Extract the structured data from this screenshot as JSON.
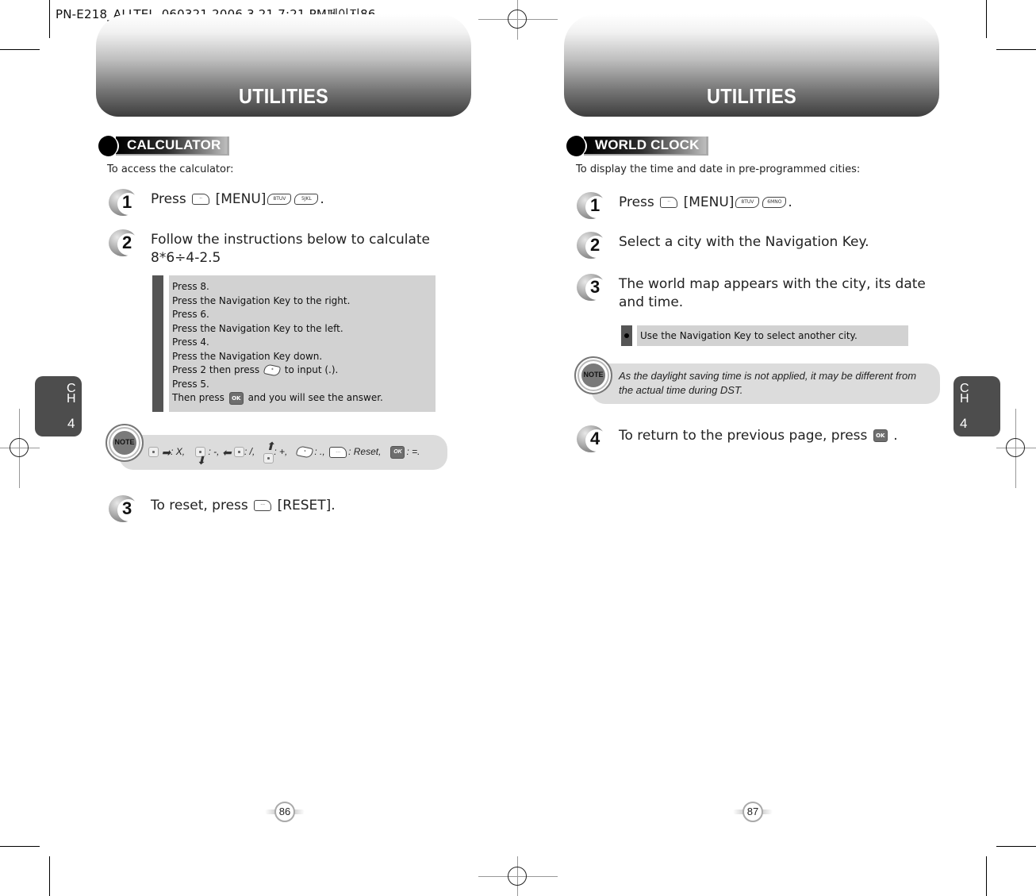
{
  "print_header": "PN-E218_ALLTEL_060321  2006.3.21 7:21 PM페이지86",
  "left_page": {
    "banner_title": "UTILITIES",
    "section_title": "CALCULATOR",
    "intro": "To access the calculator:",
    "steps": [
      {
        "number": "1",
        "text_before": "Press",
        "text_mid": "[MENU]",
        "text_after": ".",
        "keys": [
          "soft-key-icon",
          "key-8-icon",
          "key-5-icon"
        ]
      },
      {
        "number": "2",
        "line1": "Follow the instructions below to calculate",
        "line2": "8*6÷4-2.5"
      },
      {
        "number": "3",
        "text_before": "To reset, press",
        "text_after": "[RESET]."
      }
    ],
    "instructions": [
      "Press 8.",
      "Press the Navigation Key to the right.",
      "Press 6.",
      "Press the Navigation Key to the left.",
      "Press 4.",
      "Press the Navigation Key down.",
      {
        "before": "Press 2 then press",
        "after": "to input (.)."
      },
      "Press 5.",
      {
        "before": "Then press",
        "after": "and you will see the answer."
      }
    ],
    "note": {
      "icon_label": "NOTE",
      "legend": [
        {
          "symbol": "nav-right",
          "meaning": ": X,"
        },
        {
          "symbol": "nav-down",
          "meaning": ": -,"
        },
        {
          "symbol": "nav-left",
          "meaning": ": /,"
        },
        {
          "symbol": "nav-up",
          "meaning": ": +,"
        },
        {
          "symbol": "star-key",
          "meaning": ": .,"
        },
        {
          "symbol": "soft-key",
          "meaning": ": Reset,"
        },
        {
          "symbol": "ok-key",
          "meaning": ": =."
        }
      ]
    },
    "chapter_tab": {
      "letters": "CH",
      "number": "4"
    },
    "page_number": "86"
  },
  "right_page": {
    "banner_title": "UTILITIES",
    "section_title": "WORLD CLOCK",
    "intro": "To display the time and date in pre-programmed cities:",
    "steps": [
      {
        "number": "1",
        "text_before": "Press",
        "text_mid": "[MENU]",
        "text_after": ".",
        "keys": [
          "soft-key-icon",
          "key-8-icon",
          "key-6-icon"
        ]
      },
      {
        "number": "2",
        "text": "Select a city with the Navigation Key."
      },
      {
        "number": "3",
        "line1": "The world map appears with the city, its date",
        "line2": "and time."
      },
      {
        "number": "4",
        "text_before": "To return to the previous page, press",
        "text_after": "."
      }
    ],
    "bullet": "Use the Navigation Key to select another city.",
    "note": {
      "icon_label": "NOTE",
      "line1": "As the daylight saving time is not applied, it may be different from",
      "line2": "the actual time during DST."
    },
    "chapter_tab": {
      "letters": "CH",
      "number": "4"
    },
    "page_number": "87"
  },
  "keys": {
    "ok": "OK",
    "soft": "··",
    "soft_reset": "···",
    "k8": "8TUV",
    "k5": "5JKL",
    "k6": "6MNO",
    "star": "*"
  }
}
